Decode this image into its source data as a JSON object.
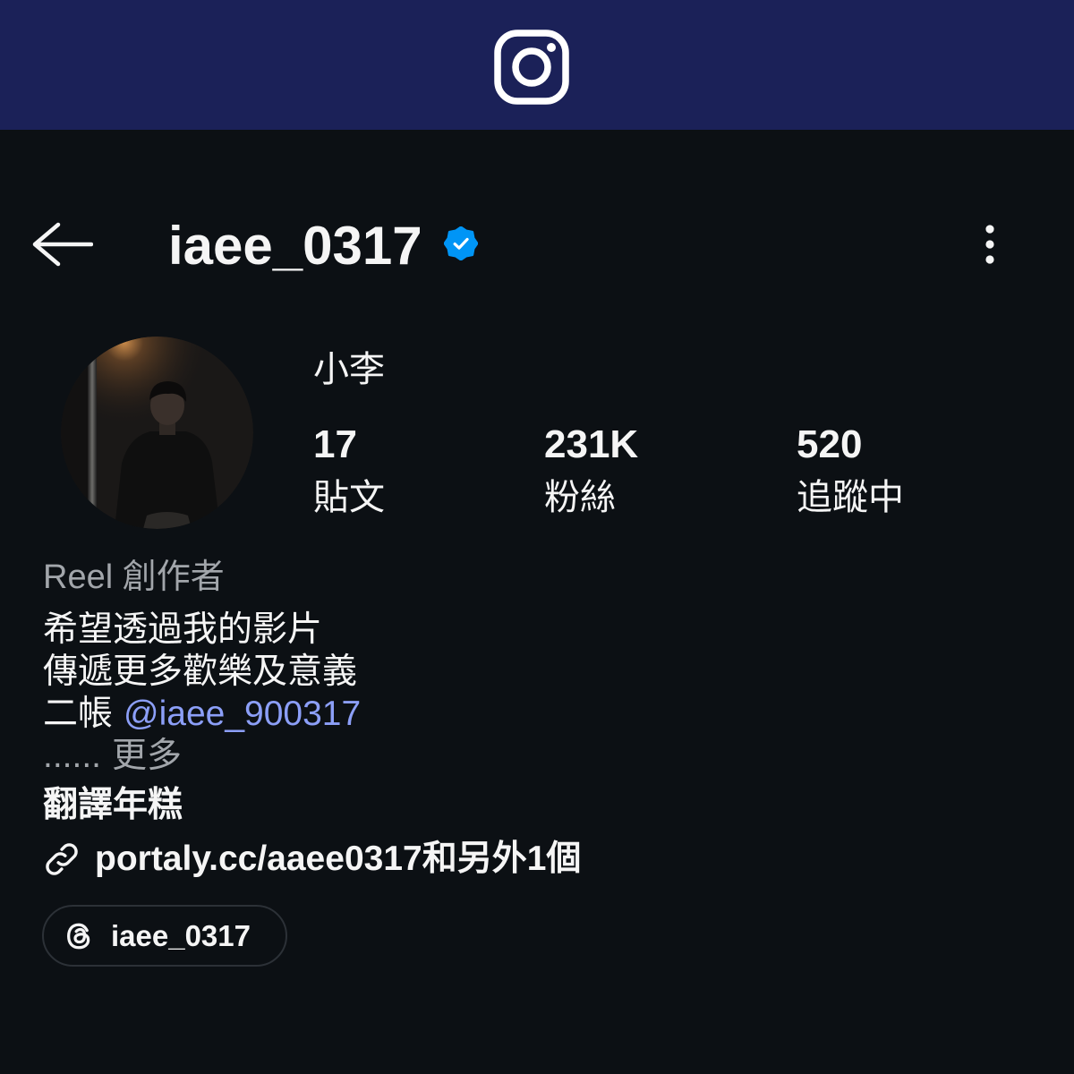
{
  "app": {
    "name": "Instagram",
    "logo_icon": "instagram-icon"
  },
  "header": {
    "back_icon": "arrow-left-icon",
    "username": "iaee_0317",
    "verified_icon": "verified-badge-icon",
    "more_icon": "more-vertical-icon"
  },
  "profile": {
    "display_name": "小李",
    "stats": [
      {
        "value": "17",
        "label": "貼文"
      },
      {
        "value": "231K",
        "label": "粉絲"
      },
      {
        "value": "520",
        "label": "追蹤中"
      }
    ],
    "category": "Reel 創作者",
    "bio": {
      "lines": [
        "希望透過我的影片",
        "傳遞更多歡樂及意義"
      ],
      "mention_prefix": "二帳",
      "mention": "@iaee_900317",
      "truncation": "......",
      "more_label": "更多"
    },
    "translate_label": "翻譯年糕",
    "link": {
      "icon": "link-icon",
      "text": "portaly.cc/aaee0317和另外1個"
    },
    "threads_badge": {
      "icon": "threads-icon",
      "label": "iaee_0317"
    }
  },
  "colors": {
    "top_bar": "#1b2158",
    "background": "#0c1014",
    "text": "#f5f5f5",
    "secondary_text": "#a2a6ab",
    "mention": "#8c9ff8",
    "verified": "#0095f6",
    "pill_border": "#2c3137"
  }
}
